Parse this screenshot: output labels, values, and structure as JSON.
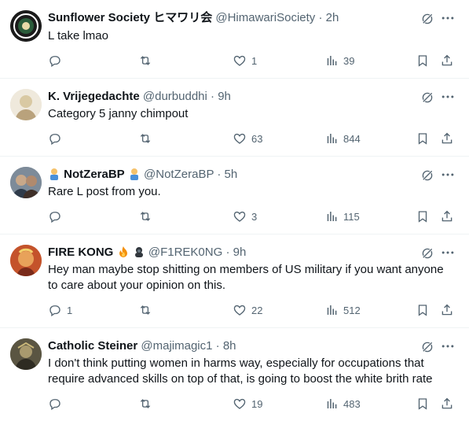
{
  "tweets": [
    {
      "name": "Sunflower Society ヒマワリ会",
      "handle": "@HimawariSociety",
      "sep": "·",
      "time": "2h",
      "text": "L take lmao",
      "reply_count": "",
      "retweet_count": "",
      "like_count": "1",
      "view_count": "39"
    },
    {
      "name": "K. Vrijegedachte",
      "handle": "@durbuddhi",
      "sep": "·",
      "time": "9h",
      "text": "Category 5 janny chimpout",
      "reply_count": "",
      "retweet_count": "",
      "like_count": "63",
      "view_count": "844"
    },
    {
      "name": "NotZeraBP",
      "handle": "@NotZeraBP",
      "sep": "·",
      "time": "5h",
      "text": "Rare L post from you.",
      "reply_count": "",
      "retweet_count": "",
      "like_count": "3",
      "view_count": "115"
    },
    {
      "name": "FIRE KONG",
      "handle": "@F1REK0NG",
      "sep": "·",
      "time": "9h",
      "text": "Hey man maybe stop shitting on members of US military if you want anyone to care about your opinion on this.",
      "reply_count": "1",
      "retweet_count": "",
      "like_count": "22",
      "view_count": "512"
    },
    {
      "name": "Catholic Steiner",
      "handle": "@majimagic1",
      "sep": "·",
      "time": "8h",
      "text": "I don't think putting women in harms way, especially for occupations that require advanced skills on top of that, is going to boost the white brith rate",
      "reply_count": "",
      "retweet_count": "",
      "like_count": "19",
      "view_count": "483"
    }
  ],
  "colors": {
    "text": "#0f1419",
    "secondary": "#536471",
    "divider": "#eff3f4"
  },
  "icons": [
    "grok-icon",
    "more-icon",
    "reply-icon",
    "retweet-icon",
    "like-icon",
    "views-icon",
    "bookmark-icon",
    "share-icon"
  ]
}
